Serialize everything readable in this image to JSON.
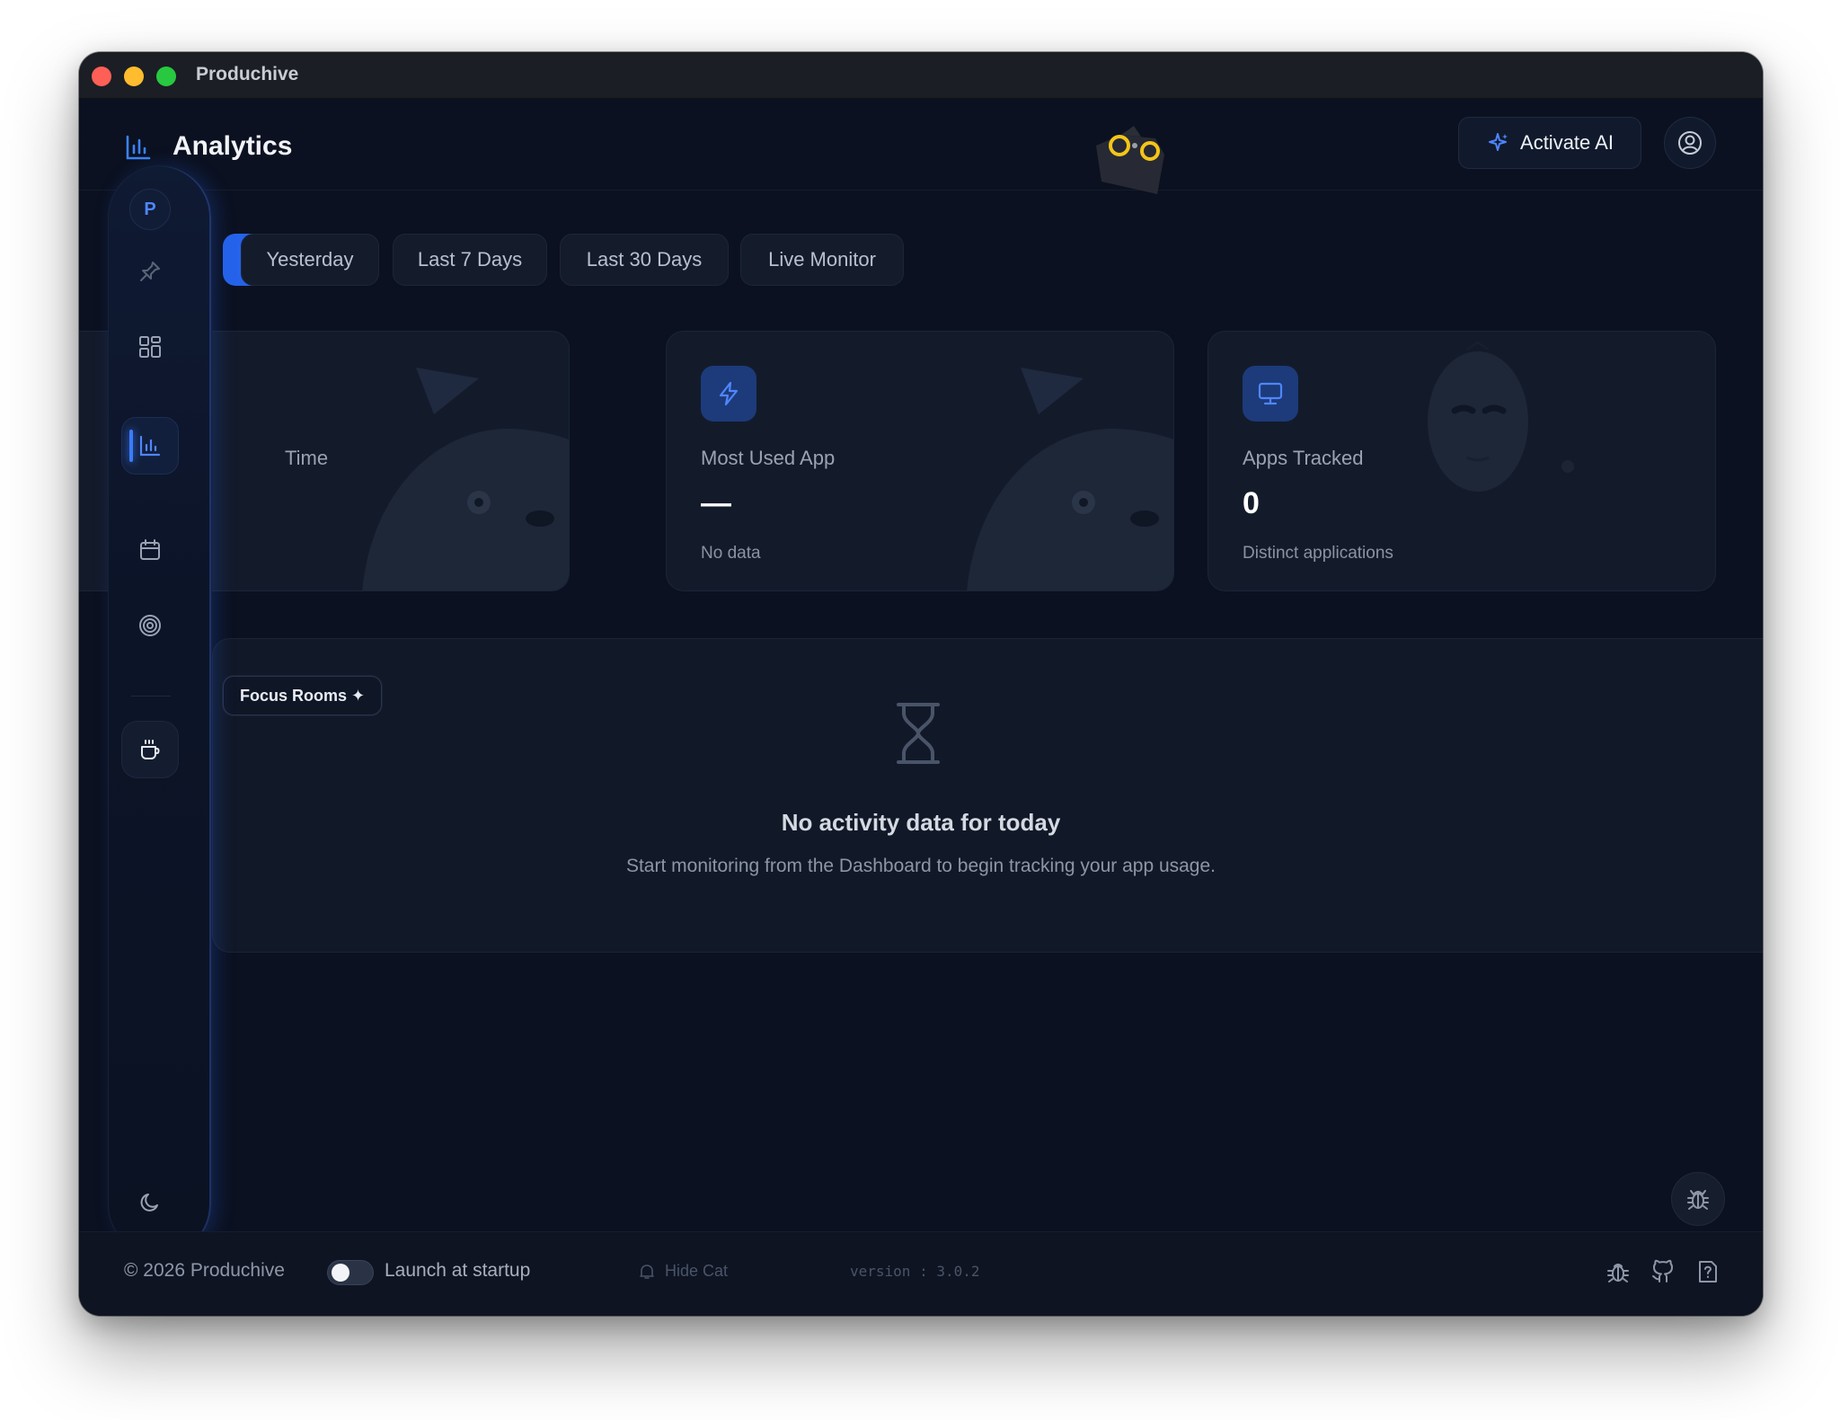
{
  "window": {
    "app_title": "Produchive"
  },
  "header": {
    "page_title": "Analytics",
    "activate_label": "Activate AI"
  },
  "sidebar": {
    "avatar_letter": "P"
  },
  "tabs": [
    {
      "label": ""
    },
    {
      "label": "Yesterday"
    },
    {
      "label": "Last 7 Days"
    },
    {
      "label": "Last 30 Days"
    },
    {
      "label": "Live Monitor"
    }
  ],
  "cards": [
    {
      "label": "Time",
      "value": "",
      "sub": ""
    },
    {
      "label": "Most Used App",
      "value": "—",
      "sub": "No data"
    },
    {
      "label": "Apps Tracked",
      "value": "0",
      "sub": "Distinct applications"
    }
  ],
  "activity": {
    "focus_pill": "Focus Rooms ✦",
    "empty_title": "No activity data for today",
    "empty_sub": "Start monitoring from the Dashboard to begin tracking your app usage."
  },
  "footer": {
    "copyright": "© 2026 Produchive",
    "launch_label": "Launch at startup",
    "launch_enabled": false,
    "hide_cat": "Hide Cat",
    "version": "version : 3.0.2"
  },
  "colors": {
    "accent": "#2563eb",
    "background": "#0b1120",
    "card": "#131b2b"
  },
  "icons": [
    "bar-chart-icon",
    "sparkle-icon",
    "user-circle-icon",
    "pin-icon",
    "grid-icon",
    "calendar-icon",
    "target-icon",
    "coffee-icon",
    "moon-icon",
    "lightning-icon",
    "monitor-icon",
    "hourglass-icon",
    "bug-icon",
    "github-icon",
    "help-icon",
    "bell-icon"
  ]
}
